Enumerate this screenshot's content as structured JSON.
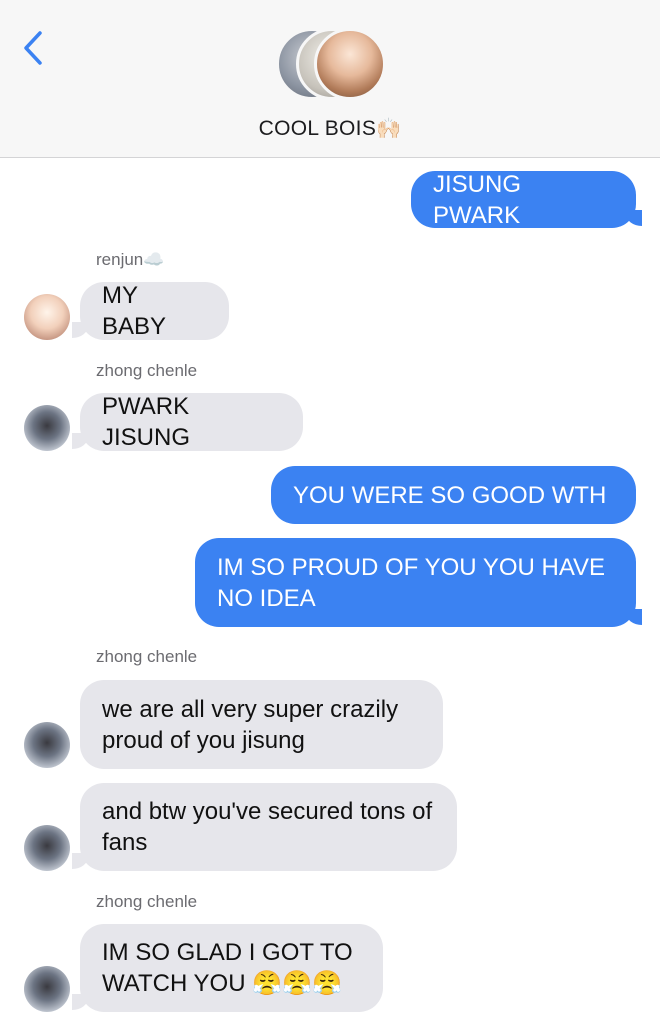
{
  "header": {
    "title": "COOL BOIS",
    "title_emoji": "🙌🏻",
    "back_icon": "chevron-left-icon"
  },
  "messages": [
    {
      "type": "sent",
      "text": "JISUNG PWARK"
    },
    {
      "type": "label",
      "text": "renjun☁️"
    },
    {
      "type": "recv",
      "text": "MY BABY"
    },
    {
      "type": "label",
      "text": "zhong chenle"
    },
    {
      "type": "recv",
      "text": "PWARK JISUNG"
    },
    {
      "type": "sent",
      "text": "YOU WERE SO GOOD WTH"
    },
    {
      "type": "sent",
      "text": "IM SO PROUD OF YOU YOU HAVE NO IDEA"
    },
    {
      "type": "label",
      "text": "zhong chenle"
    },
    {
      "type": "recv",
      "text": "we are all very super crazily proud of you jisung"
    },
    {
      "type": "recv",
      "text": "and btw you've secured tons of fans"
    },
    {
      "type": "label",
      "text": "zhong chenle"
    },
    {
      "type": "recv",
      "text": "IM SO GLAD I GOT TO WATCH YOU 😤😤😤"
    }
  ],
  "colors": {
    "sent_bubble": "#3b82f2",
    "recv_bubble": "#e6e6eb",
    "back_arrow": "#3b82f2"
  }
}
